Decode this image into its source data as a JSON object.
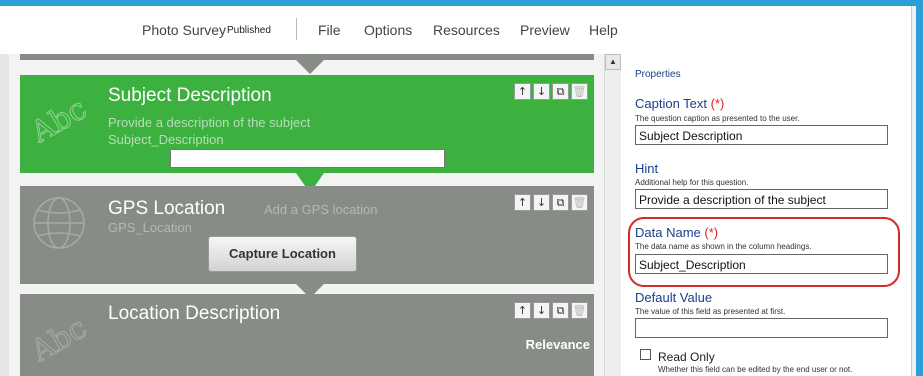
{
  "header": {
    "title": "Photo Survey",
    "status": "Published",
    "menu": [
      "File",
      "Options",
      "Resources",
      "Preview",
      "Help"
    ]
  },
  "questions": [
    {
      "title": "Subject Description",
      "hint": "Provide a description of the subject",
      "name": "Subject_Description",
      "icon": "abc-text-icon",
      "selected": true
    },
    {
      "title": "GPS Location",
      "hint": "Add a GPS location",
      "name": "GPS_Location",
      "icon": "globe-icon",
      "button": "Capture Location",
      "selected": false
    },
    {
      "title": "Location Description",
      "icon": "abc-text-icon",
      "badge": "Relevance",
      "selected": false
    }
  ],
  "properties": {
    "title": "Properties",
    "caption": {
      "label": "Caption Text",
      "required": "(*)",
      "desc": "The question caption as presented to the user.",
      "value": "Subject Description"
    },
    "hint": {
      "label": "Hint",
      "desc": "Additional help for this question.",
      "value": "Provide a description of the subject"
    },
    "dataname": {
      "label": "Data Name",
      "required": "(*)",
      "desc": "The data name as shown in the column headings.",
      "value": "Subject_Description"
    },
    "default": {
      "label": "Default Value",
      "desc": "The value of this field as presented at first.",
      "value": ""
    },
    "readonly": {
      "label": "Read Only",
      "desc": "Whether this field can be edited by the end user or not.",
      "checked": false
    }
  },
  "colors": {
    "accent": "#2a9fd8",
    "selected_card": "#3db140",
    "card": "#878c87",
    "label": "#1a3e8c",
    "required": "#e02020",
    "highlight": "#d42b2b"
  }
}
